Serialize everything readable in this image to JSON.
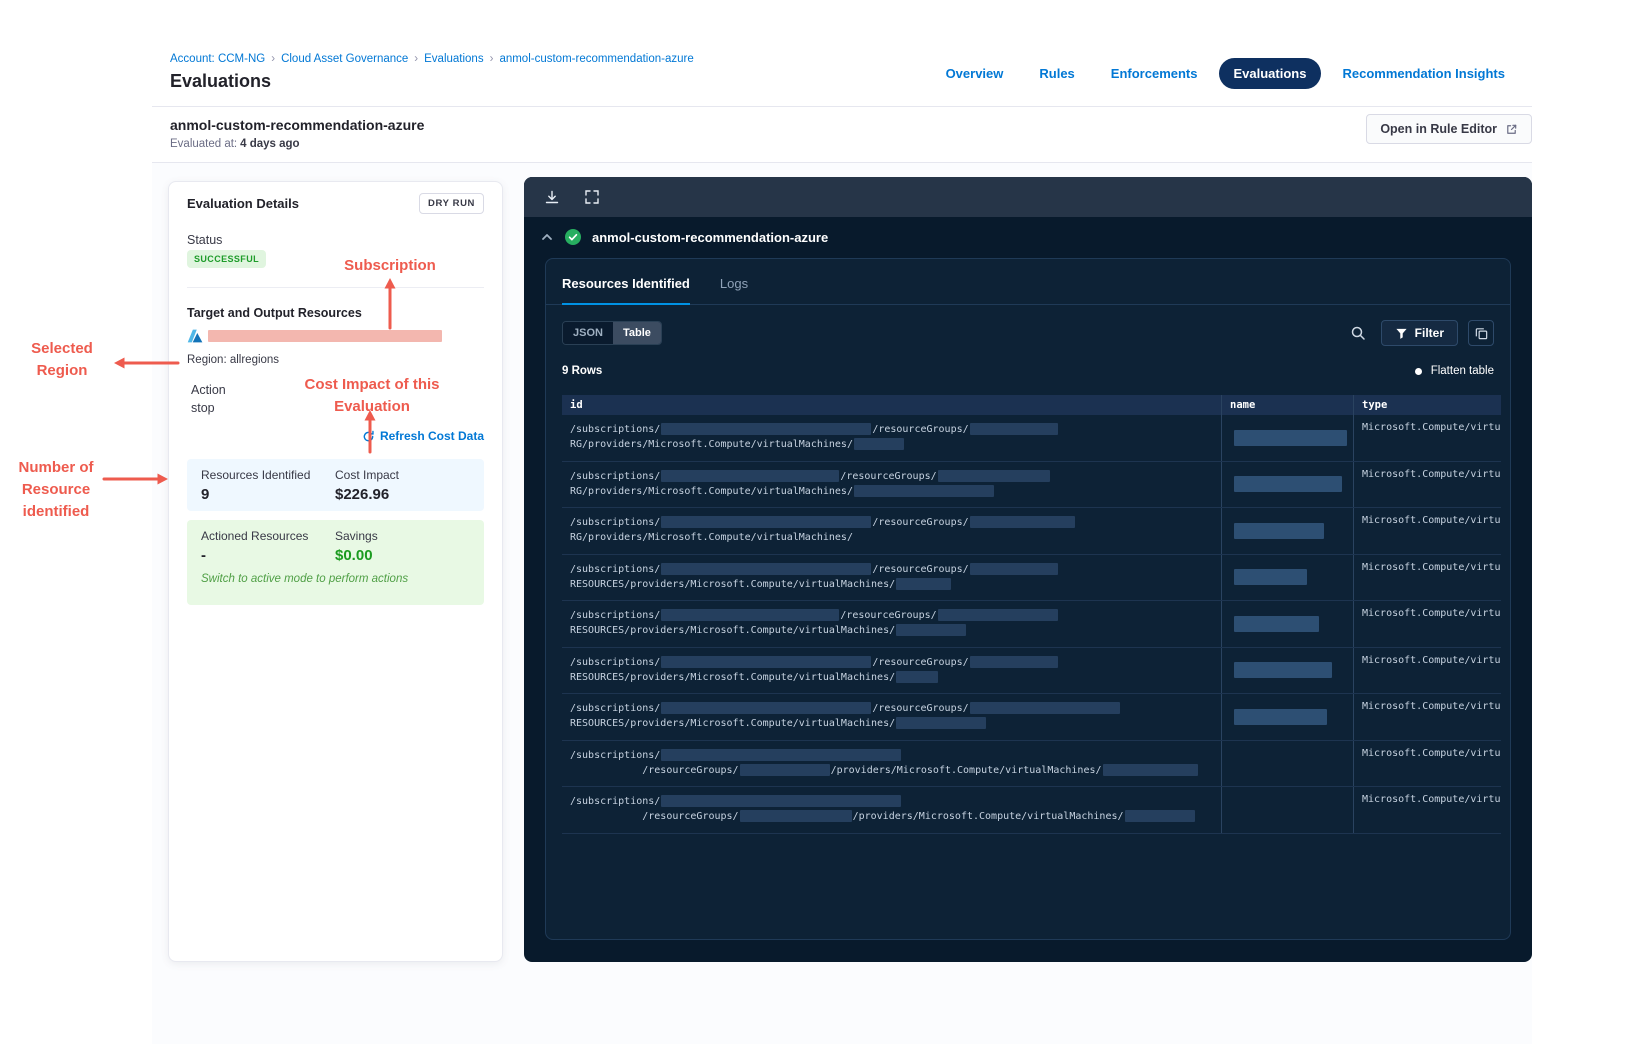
{
  "colors": {
    "accent_blue": "#0278d5",
    "annotation_red": "#ee5b4e",
    "success_green": "#1e9c2a",
    "panel_navy": "#081a2c",
    "redaction_pink": "#f3b7af"
  },
  "breadcrumb": {
    "items": [
      "Account: CCM-NG",
      "Cloud Asset Governance",
      "Evaluations",
      "anmol-custom-recommendation-azure"
    ]
  },
  "page": {
    "title": "Evaluations"
  },
  "nav": {
    "items": [
      {
        "label": "Overview",
        "active": false
      },
      {
        "label": "Rules",
        "active": false
      },
      {
        "label": "Enforcements",
        "active": false
      },
      {
        "label": "Evaluations",
        "active": true
      },
      {
        "label": "Recommendation Insights",
        "active": false
      }
    ]
  },
  "subheader": {
    "title": "anmol-custom-recommendation-azure",
    "evaluated_label": "Evaluated at:",
    "evaluated_value": "4 days ago",
    "open_rule_editor_label": "Open in Rule Editor"
  },
  "details": {
    "title": "Evaluation Details",
    "dry_run_badge": "DRY RUN",
    "status_label": "Status",
    "status_value": "SUCCESSFUL",
    "target_label": "Target and Output Resources",
    "region_text": "Region: allregions",
    "action_label": "Action",
    "action_value": "stop",
    "refresh_link_label": "Refresh Cost Data",
    "resources_identified_label": "Resources Identified",
    "resources_identified_value": "9",
    "cost_impact_label": "Cost Impact",
    "cost_impact_value": "$226.96",
    "actioned_label": "Actioned Resources",
    "actioned_value": "-",
    "savings_label": "Savings",
    "savings_value": "$0.00",
    "active_mode_note": "Switch to active mode to perform actions"
  },
  "annotations": {
    "subscription": "Subscription",
    "selected_region": "Selected Region",
    "cost_impact": "Cost Impact of this Evaluation",
    "resources_identified": "Number of Resource identified",
    "color": "#ee5b4e"
  },
  "viewer": {
    "section_title": "anmol-custom-recommendation-azure",
    "tabs": [
      {
        "label": "Resources Identified",
        "active": true
      },
      {
        "label": "Logs",
        "active": false
      }
    ],
    "view_toggle": [
      {
        "label": "JSON",
        "active": false
      },
      {
        "label": "Table",
        "active": true
      }
    ],
    "filter_label": "Filter",
    "rows_count": "9 Rows",
    "flatten_label": "Flatten table",
    "table": {
      "columns": [
        "id",
        "name",
        "type"
      ],
      "rows": [
        {
          "id": [
            [
              {
                "t": "/subscriptions/"
              },
              {
                "r": 210
              },
              {
                "t": "/resourceGroups/"
              },
              {
                "r": 88
              }
            ],
            [
              {
                "t": "RG/providers/Microsoft.Compute/virtualMachines/"
              },
              {
                "r": 50
              }
            ]
          ],
          "name_redact": 113,
          "type": "Microsoft.Compute/virtu"
        },
        {
          "id": [
            [
              {
                "t": "/subscriptions/"
              },
              {
                "r": 178
              },
              {
                "t": "/resourceGroups/"
              },
              {
                "r": 112
              }
            ],
            [
              {
                "t": "RG/providers/Microsoft.Compute/virtualMachines/"
              },
              {
                "r": 140
              }
            ]
          ],
          "name_redact": 108,
          "type": "Microsoft.Compute/virtu"
        },
        {
          "id": [
            [
              {
                "t": "/subscriptions/"
              },
              {
                "r": 210
              },
              {
                "t": "/resourceGroups/"
              },
              {
                "r": 105
              }
            ],
            [
              {
                "t": "RG/providers/Microsoft.Compute/virtualMachines/"
              }
            ]
          ],
          "name_redact": 90,
          "type": "Microsoft.Compute/virtu"
        },
        {
          "id": [
            [
              {
                "t": "/subscriptions/"
              },
              {
                "r": 210
              },
              {
                "t": "/resourceGroups/"
              },
              {
                "r": 88
              }
            ],
            [
              {
                "t": "RESOURCES/providers/Microsoft.Compute/virtualMachines/"
              },
              {
                "r": 55
              }
            ]
          ],
          "name_redact": 73,
          "type": "Microsoft.Compute/virtu"
        },
        {
          "id": [
            [
              {
                "t": "/subscriptions/"
              },
              {
                "r": 178
              },
              {
                "t": "/resourceGroups/"
              },
              {
                "r": 120
              }
            ],
            [
              {
                "t": "RESOURCES/providers/Microsoft.Compute/virtualMachines/"
              },
              {
                "r": 70
              }
            ]
          ],
          "name_redact": 85,
          "type": "Microsoft.Compute/virtu"
        },
        {
          "id": [
            [
              {
                "t": "/subscriptions/"
              },
              {
                "r": 210
              },
              {
                "t": "/resourceGroups/"
              },
              {
                "r": 88
              }
            ],
            [
              {
                "t": "RESOURCES/providers/Microsoft.Compute/virtualMachines/"
              },
              {
                "r": 42
              }
            ]
          ],
          "name_redact": 98,
          "type": "Microsoft.Compute/virtu"
        },
        {
          "id": [
            [
              {
                "t": "/subscriptions/"
              },
              {
                "r": 210
              },
              {
                "t": "/resourceGroups/"
              },
              {
                "r": 150
              }
            ],
            [
              {
                "t": "RESOURCES/providers/Microsoft.Compute/virtualMachines/"
              },
              {
                "r": 90
              }
            ]
          ],
          "name_redact": 93,
          "type": "Microsoft.Compute/virtu"
        },
        {
          "id": [
            [
              {
                "t": "/subscriptions/"
              },
              {
                "r": 240
              }
            ],
            [
              {
                "t": "            /resourceGroups/"
              },
              {
                "r": 90
              },
              {
                "t": "/providers/Microsoft.Compute/virtualMachines/"
              },
              {
                "r": 95
              }
            ]
          ],
          "name_redact": 0,
          "type": "Microsoft.Compute/virtu"
        },
        {
          "id": [
            [
              {
                "t": "/subscriptions/"
              },
              {
                "r": 240
              }
            ],
            [
              {
                "t": "            /resourceGroups/"
              },
              {
                "r": 112
              },
              {
                "t": "/providers/Microsoft.Compute/virtualMachines/"
              },
              {
                "r": 70
              }
            ]
          ],
          "name_redact": 0,
          "type": "Microsoft.Compute/virtu"
        }
      ]
    }
  }
}
